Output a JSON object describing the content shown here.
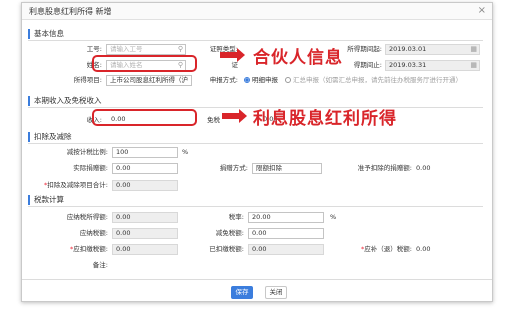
{
  "dialog": {
    "title": "利息股息红利所得 新增",
    "close_glyph": "×"
  },
  "section_basic": {
    "title": "基本信息",
    "employee_id": {
      "label": "工号:",
      "placeholder": "请输入工号"
    },
    "id_type": {
      "label": "证照类型:",
      "value": ""
    },
    "period_start": {
      "label": "所得期间起:",
      "value": "2019.03.01"
    },
    "name": {
      "label": "姓名:",
      "placeholder": "请输入姓名"
    },
    "id_number": {
      "label": "证",
      "value": ""
    },
    "period_end": {
      "label": "得期间止:",
      "value": "2019.03.31"
    },
    "project": {
      "label": "所得项目:",
      "value": "上市公司股息红利所得（沪"
    },
    "declare_method": {
      "label": "申报方式:",
      "options": [
        {
          "label": "明细申报",
          "selected": true
        },
        {
          "label": "汇总申报（如需汇总申报，请先前往办税服务厅进行开通）",
          "selected": false
        }
      ]
    }
  },
  "section_income": {
    "title": "本期收入及免税收入",
    "income": {
      "label": "收入:",
      "value": "0.00"
    },
    "tax_free": {
      "label": "免税",
      "value": "0.00"
    }
  },
  "section_deduct": {
    "title": "扣除及减除",
    "ratio": {
      "label": "减按计税比例:",
      "value": "100",
      "unit": "%"
    },
    "actual_donation": {
      "label": "实际捐赠额:",
      "value": "0.00"
    },
    "donation_method": {
      "label": "捐赠方式:",
      "value": "限额扣除"
    },
    "allowed_donation": {
      "label": "准予扣除的捐赠额:",
      "value": "0.00"
    },
    "total": {
      "label": "扣除及减除项目合计:",
      "value": "0.00"
    }
  },
  "section_tax": {
    "title": "税款计算",
    "taxable_income": {
      "label": "应纳税所得额:",
      "value": "0.00"
    },
    "rate": {
      "label": "税率:",
      "value": "20.00",
      "unit": "%"
    },
    "tax_payable": {
      "label": "应纳税额:",
      "value": "0.00"
    },
    "tax_reduction": {
      "label": "减免税额:",
      "value": "0.00"
    },
    "should_withhold": {
      "label": "应扣缴税额:",
      "value": "0.00"
    },
    "withheld": {
      "label": "已扣缴税额:",
      "value": "0.00"
    },
    "refund": {
      "label": "应补（退）税额:",
      "value": "0.00"
    },
    "remark": {
      "label": "备注:",
      "value": ""
    }
  },
  "buttons": {
    "save": "保存",
    "close": "关闭"
  },
  "annotations": {
    "note1": "合伙人信息",
    "note2": "利息股息红利所得",
    "color": "#d9252a"
  },
  "colors": {
    "accent": "#3b7ddd",
    "highlight": "#d9252a"
  },
  "icons": {
    "search": "search-icon",
    "calendar": "calendar-icon"
  }
}
